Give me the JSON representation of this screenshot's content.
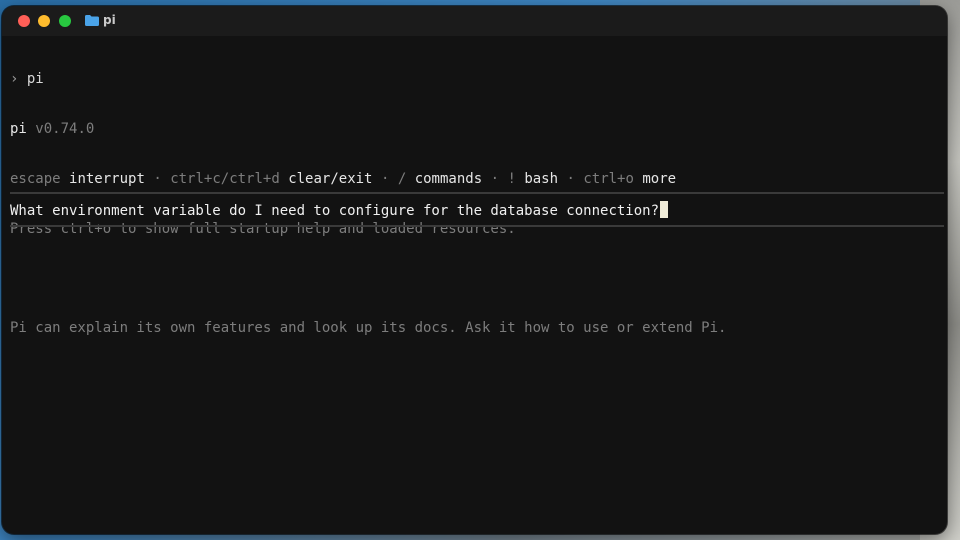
{
  "window": {
    "title": "pi",
    "folder_icon": "folder-icon",
    "traffic_lights": [
      "close",
      "minimize",
      "zoom"
    ]
  },
  "terminal": {
    "prompt_symbol": "›",
    "command": "pi",
    "app_name": "pi",
    "version": "v0.74.0",
    "shortcuts": [
      {
        "key": "escape",
        "action": "interrupt"
      },
      {
        "key": "ctrl+c/ctrl+d",
        "action": "clear/exit"
      },
      {
        "key": "/",
        "action": "commands"
      },
      {
        "key": "!",
        "action": "bash"
      },
      {
        "key": "ctrl+o",
        "action": "more"
      }
    ],
    "separator": "·",
    "help_line": "Press ctrl+o to show full startup help and loaded resources.",
    "tip_line": "Pi can explain its own features and look up its docs. Ask it how to use or extend Pi."
  },
  "input": {
    "value": "What environment variable do I need to configure for the database connection?"
  },
  "colors": {
    "background": "#121212",
    "dim_text": "#7d7d7d",
    "bright_text": "#e6e6e6",
    "cursor": "#f0ecd8"
  }
}
